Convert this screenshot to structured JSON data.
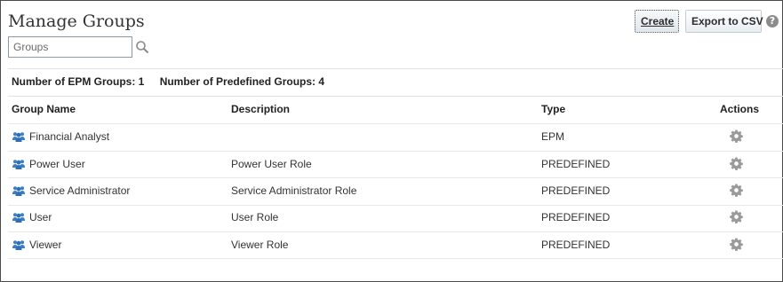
{
  "page": {
    "title": "Manage Groups"
  },
  "search": {
    "placeholder": "Groups",
    "value": ""
  },
  "toolbar": {
    "create_label": "Create",
    "export_label": "Export to CSV",
    "help_label": "?"
  },
  "summary": {
    "epm_groups": "Number of EPM Groups: 1",
    "predefined_groups": "Number of Predefined Groups: 4"
  },
  "table": {
    "columns": [
      "Group Name",
      "Description",
      "Type",
      "Actions"
    ],
    "rows": [
      {
        "name": "Financial Analyst",
        "description": "",
        "type": "EPM"
      },
      {
        "name": "Power User",
        "description": "Power User Role",
        "type": "PREDEFINED"
      },
      {
        "name": "Service Administrator",
        "description": "Service Administrator Role",
        "type": "PREDEFINED"
      },
      {
        "name": "User",
        "description": "User Role",
        "type": "PREDEFINED"
      },
      {
        "name": "Viewer",
        "description": "Viewer Role",
        "type": "PREDEFINED"
      }
    ]
  },
  "icons": {
    "search": "search-icon",
    "help": "help-icon",
    "group": "group-icon",
    "actions": "gear-icon"
  },
  "colors": {
    "group_icon": "#3d7ec9",
    "gear_icon": "#9a9a9a",
    "help_icon": "#8c8c8c"
  }
}
